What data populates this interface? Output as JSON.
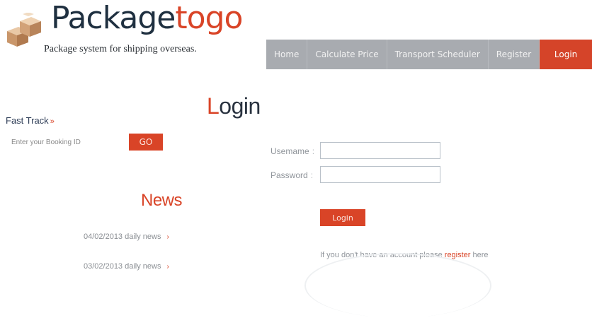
{
  "brand": {
    "title_part1": "Package",
    "title_part2": "togo",
    "tagline": "Package system for shipping overseas.",
    "logo_icon": "stacked-boxes-icon"
  },
  "nav": {
    "items": [
      {
        "label": "Home"
      },
      {
        "label": "Calculate Price"
      },
      {
        "label": "Transport Scheduler"
      },
      {
        "label": "Register"
      },
      {
        "label": "Login",
        "active": true
      }
    ]
  },
  "fast_track": {
    "title": "Fast Track",
    "arrow": "»",
    "placeholder": "Enter your Booking ID",
    "go_label": "GO"
  },
  "news": {
    "title": "News",
    "items": [
      {
        "label": "04/02/2013 daily news",
        "bullet": "›"
      },
      {
        "label": "03/02/2013 daily news",
        "bullet": "›"
      }
    ]
  },
  "login": {
    "title_first": "L",
    "title_rest": "ogin",
    "username_label": "Usemame",
    "password_label": "Password",
    "colon": ":",
    "submit_label": "Login",
    "note_before": "If you don't have an account please ",
    "note_link": "register",
    "note_after": " here"
  },
  "colors": {
    "accent": "#d94427",
    "nav_bg": "#a8abb0",
    "text_dark": "#1f3040"
  }
}
